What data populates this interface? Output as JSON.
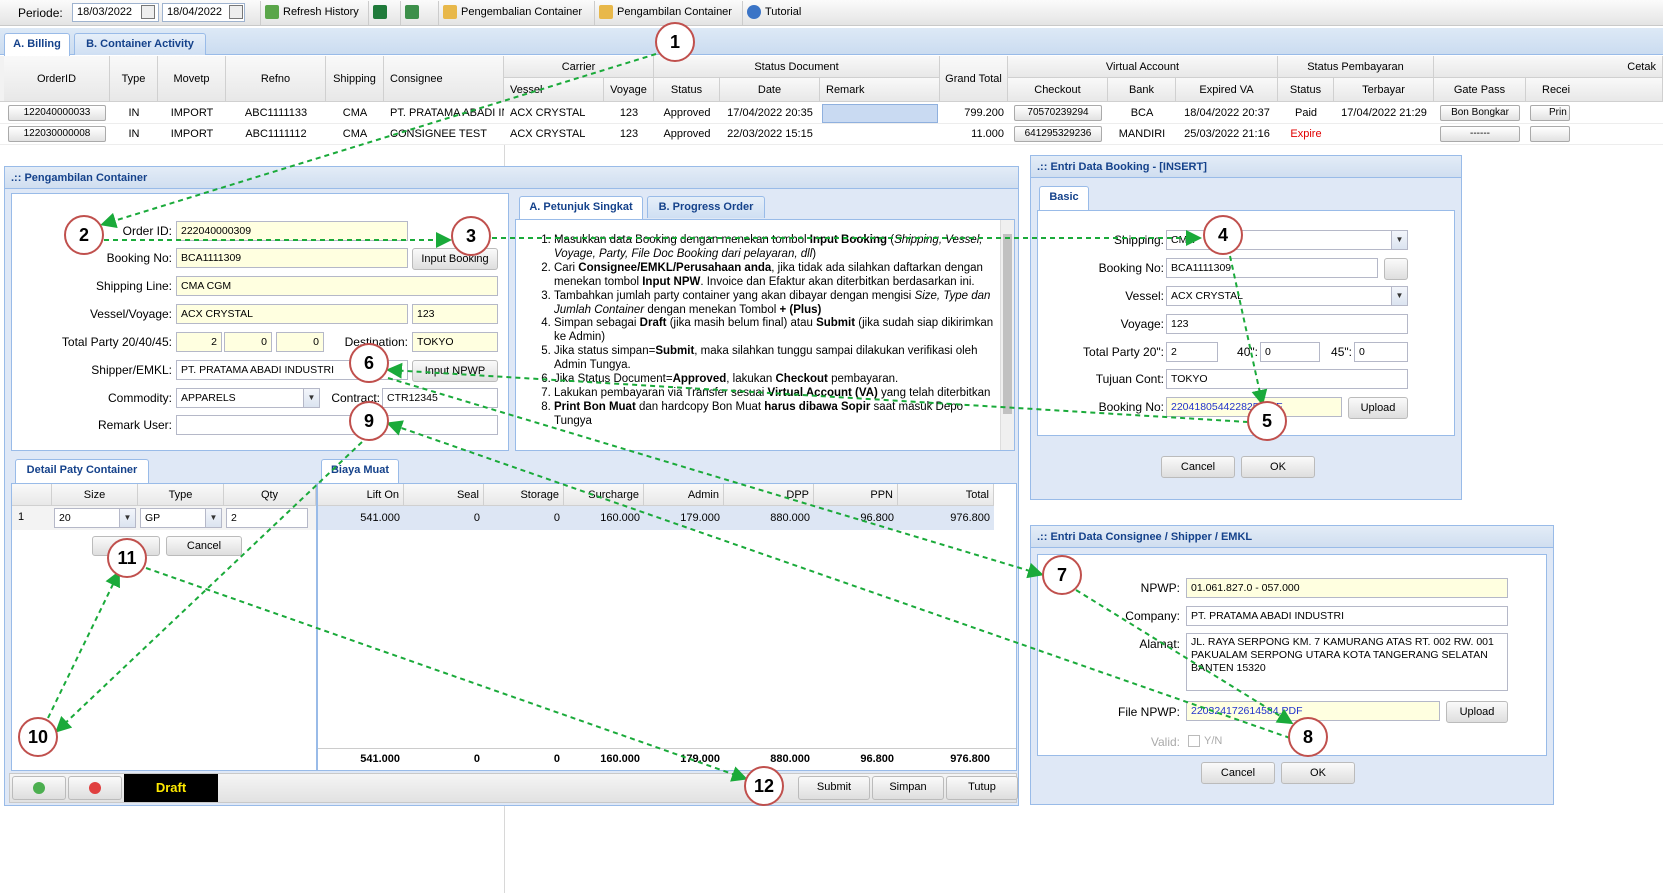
{
  "toolbar": {
    "periode_label": "Periode:",
    "date_from": "18/03/2022",
    "date_to": "18/04/2022",
    "refresh": "Refresh History",
    "pengembalian": "Pengembalian Container",
    "pengambilan": "Pengambilan Container",
    "tutorial": "Tutorial"
  },
  "main_tabs": [
    "A. Billing",
    "B. Container Activity"
  ],
  "grid": {
    "group_headers": {
      "carrier": "Carrier",
      "status_document": "Status Document",
      "virtual_account": "Virtual Account",
      "status_pembayaran": "Status Pembayaran",
      "cetak": "Cetak"
    },
    "headers": {
      "orderid": "OrderID",
      "type": "Type",
      "movetp": "Movetp",
      "refno": "Refno",
      "shipping": "Shipping",
      "consignee": "Consignee",
      "vessel": "Vessel",
      "voyage": "Voyage",
      "status": "Status",
      "date": "Date",
      "remark": "Remark",
      "grand_total": "Grand Total",
      "checkout": "Checkout",
      "bank": "Bank",
      "expired_va": "Expired VA",
      "pay_status": "Status",
      "terbayar": "Terbayar",
      "gate_pass": "Gate Pass",
      "receipt": "Recei"
    },
    "rows": [
      {
        "orderid": "122040000033",
        "type": "IN",
        "movetp": "IMPORT",
        "refno": "ABC1111133",
        "shipping": "CMA",
        "consignee": "PT. PRATAMA ABADI IN",
        "vessel": "ACX CRYSTAL",
        "voyage": "123",
        "status": "Approved",
        "date": "17/04/2022 20:35",
        "remark": "",
        "grand_total": "799.200",
        "checkout": "70570239294",
        "bank": "BCA",
        "expired_va": "18/04/2022 20:37",
        "pay_status": "Paid",
        "terbayar": "17/04/2022 21:29",
        "gate_pass": "Bon Bongkar",
        "receipt": "Prin"
      },
      {
        "orderid": "122030000008",
        "type": "IN",
        "movetp": "IMPORT",
        "refno": "ABC1111112",
        "shipping": "CMA",
        "consignee": "CONSIGNEE TEST",
        "vessel": "ACX CRYSTAL",
        "voyage": "123",
        "status": "Approved",
        "date": "22/03/2022 15:15",
        "remark": "",
        "grand_total": "11.000",
        "checkout": "641295329236",
        "bank": "MANDIRI",
        "expired_va": "25/03/2022 21:16",
        "pay_status": "Expire",
        "terbayar": "",
        "gate_pass": "------",
        "receipt": ""
      }
    ],
    "expire_color": "#e00000"
  },
  "pengambilan": {
    "title": ".:: Pengambilan Container",
    "order_id_label": "Order ID:",
    "order_id": "222040000309",
    "booking_no_label": "Booking No:",
    "booking_no": "BCA1111309",
    "input_booking": "Input Booking",
    "shipping_line_label": "Shipping Line:",
    "shipping_line": "CMA CGM",
    "vessel_voyage_label": "Vessel/Voyage:",
    "vessel": "ACX CRYSTAL",
    "voyage": "123",
    "total_party_label": "Total Party 20/40/45:",
    "p20": "2",
    "p40": "0",
    "p45": "0",
    "destination_label": "Destination:",
    "destination": "TOKYO",
    "shipper_label": "Shipper/EMKL:",
    "shipper": "PT. PRATAMA ABADI INDUSTRI",
    "input_npwp": "Input NPWP",
    "commodity_label": "Commodity:",
    "commodity": "APPARELS",
    "contract_label": "Contract:",
    "contract": "CTR12345",
    "remark_label": "Remark User:",
    "remark": "",
    "tabs": [
      "A. Petunjuk Singkat",
      "B. Progress Order"
    ],
    "instructions": [
      "Masukkan data Booking dengan menekan tombol <b>Input Booking</b> (<i>Shipping, Vessel, Voyage, Party, File Doc Booking dari pelayaran, dll</i>)",
      "Cari <b>Consignee/EMKL/Perusahaan anda</b>, jika tidak ada silahkan daftarkan dengan menekan tombol <b>Input NPW</b>. Invoice dan Efaktur akan diterbitkan berdasarkan ini.",
      "Tambahkan jumlah party container yang akan dibayar dengan mengisi <i>Size, Type dan Jumlah Container</i> dengan menekan Tombol <b>+ (Plus)</b>",
      "Simpan sebagai <b>Draft</b> (jika masih belum final) atau <b>Submit</b> (jika sudah siap dikirimkan ke Admin)",
      "Jika status simpan=<b>Submit</b>, maka silahkan tunggu sampai dilakukan verifikasi oleh Admin Tungya.",
      "Jika Status Document=<b>Approved</b>, lakukan <b>Checkout</b> pembayaran.",
      "Lakukan pembayaran via Transfer sesuai <b>Virtual Account (VA)</b> yang telah diterbitkan",
      "<b>Print Bon Muat</b> dan hardcopy Bon Muat <b>harus dibawa Sopir</b> saat masuk Depo Tungya"
    ],
    "detail_title": "Detail Paty Container",
    "detail_headers": [
      "Size",
      "Type",
      "Qty"
    ],
    "detail_row": {
      "no": "1",
      "size": "20",
      "type": "GP",
      "qty": "2"
    },
    "detail_ok": "OK",
    "detail_cancel": "Cancel",
    "biaya_title": "Biaya Muat",
    "biaya_headers": [
      "Lift On",
      "Seal",
      "Storage",
      "Surcharge",
      "Admin",
      "DPP",
      "PPN",
      "Total"
    ],
    "biaya_row": [
      "541.000",
      "0",
      "0",
      "160.000",
      "179.000",
      "880.000",
      "96.800",
      "976.800"
    ],
    "biaya_totals": [
      "541.000",
      "0",
      "0",
      "160.000",
      "179.000",
      "880.000",
      "96.800",
      "976.800"
    ],
    "status": "Draft",
    "submit": "Submit",
    "simpan": "Simpan",
    "tutup": "Tutup"
  },
  "booking_dialog": {
    "title": ".:: Entri Data Booking - [INSERT]",
    "tab": "Basic",
    "shipping_label": "Shipping:",
    "shipping": "CMA",
    "booking_no_label": "Booking No:",
    "booking_no": "BCA1111309",
    "vessel_label": "Vessel:",
    "vessel": "ACX CRYSTAL",
    "voyage_label": "Voyage:",
    "voyage": "123",
    "total_party_label": "Total Party 20\":",
    "p20": "2",
    "l40": "40\":",
    "p40": "0",
    "l45": "45\":",
    "p45": "0",
    "tujuan_label": "Tujuan Cont:",
    "tujuan": "TOKYO",
    "file_label": "Booking No:",
    "file": "220418054422825.PDF",
    "upload": "Upload",
    "cancel": "Cancel",
    "ok": "OK"
  },
  "consignee_dialog": {
    "title": ".:: Entri Data Consignee / Shipper / EMKL",
    "npwp_label": "NPWP:",
    "npwp": "01.061.827.0 - 057.000",
    "company_label": "Company:",
    "company": "PT. PRATAMA ABADI INDUSTRI",
    "alamat_label": "Alamat:",
    "alamat": "JL. RAYA SERPONG KM. 7 KAMURANG ATAS RT. 002 RW. 001 PAKUALAM SERPONG UTARA KOTA  TANGERANG  SELATAN BANTEN 15320",
    "file_label": "File NPWP:",
    "file": "220324172614584.PDF",
    "upload": "Upload",
    "valid_label": "Valid:",
    "valid_yn": "Y/N",
    "cancel": "Cancel",
    "ok": "OK"
  },
  "callouts": [
    "1",
    "2",
    "3",
    "4",
    "5",
    "6",
    "7",
    "8",
    "9",
    "10",
    "11",
    "12"
  ],
  "arrow_color": "#1aaa3a"
}
